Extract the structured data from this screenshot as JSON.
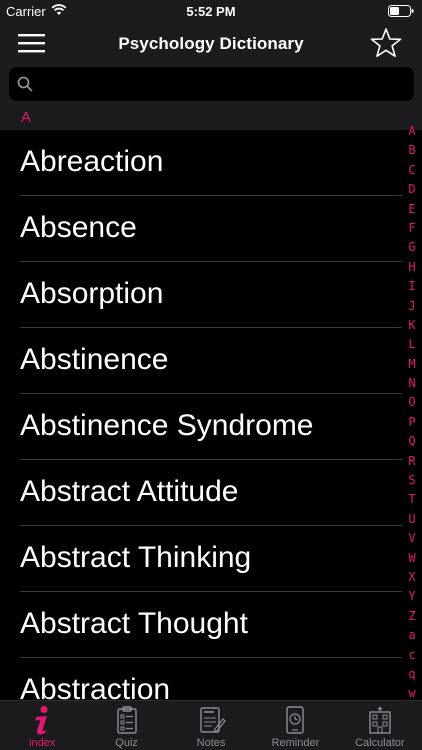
{
  "status_bar": {
    "carrier": "Carrier",
    "time": "5:52 PM"
  },
  "nav": {
    "title": "Psychology Dictionary",
    "menu_icon": "hamburger-icon",
    "favorite_icon": "star-icon"
  },
  "search": {
    "value": "",
    "placeholder": "",
    "icon": "search-icon"
  },
  "section": {
    "letter": "A"
  },
  "terms": [
    "Abreaction",
    "Absence",
    "Absorption",
    "Abstinence",
    "Abstinence Syndrome",
    "Abstract Attitude",
    "Abstract Thinking",
    "Abstract Thought",
    "Abstraction"
  ],
  "index_letters": [
    "A",
    "B",
    "C",
    "D",
    "E",
    "F",
    "G",
    "H",
    "I",
    "J",
    "K",
    "L",
    "M",
    "N",
    "O",
    "P",
    "Q",
    "R",
    "S",
    "T",
    "U",
    "V",
    "W",
    "X",
    "Y",
    "Z",
    "a",
    "c",
    "q",
    "w"
  ],
  "tabs": [
    {
      "label": "index",
      "icon": "info-icon",
      "active": true
    },
    {
      "label": "Quiz",
      "icon": "clipboard-list-icon",
      "active": false
    },
    {
      "label": "Notes",
      "icon": "notes-icon",
      "active": false
    },
    {
      "label": "Reminder",
      "icon": "clock-phone-icon",
      "active": false
    },
    {
      "label": "Calculator",
      "icon": "hospital-icon",
      "active": false
    }
  ],
  "colors": {
    "accent": "#e0196e",
    "background": "#000000",
    "bar": "#1c1c1e",
    "divider": "#3a3a3c"
  }
}
